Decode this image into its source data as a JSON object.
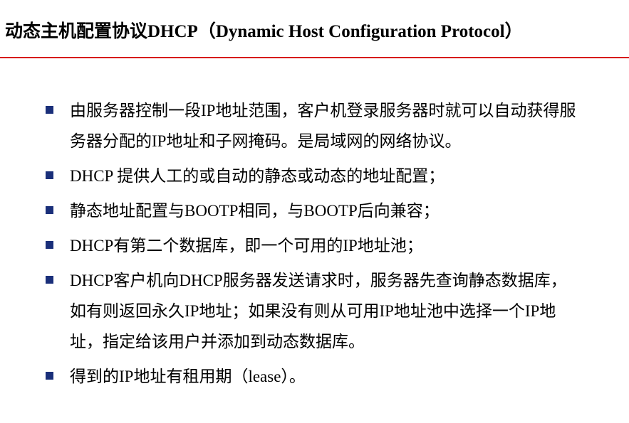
{
  "slide": {
    "title": "动态主机配置协议DHCP（Dynamic Host Configuration Protocol）",
    "accent_color": "#d7141a",
    "bullet_color": "#1a2f7a",
    "bullets": [
      {
        "text": "由服务器控制一段IP地址范围，客户机登录服务器时就可以自动获得服务器分配的IP地址和子网掩码。是局域网的网络协议。"
      },
      {
        "text": "DHCP 提供人工的或自动的静态或动态的地址配置；"
      },
      {
        "text": "静态地址配置与BOOTP相同，与BOOTP后向兼容；"
      },
      {
        "text": "DHCP有第二个数据库，即一个可用的IP地址池；"
      },
      {
        "text": "DHCP客户机向DHCP服务器发送请求时，服务器先查询静态数据库，如有则返回永久IP地址；如果没有则从可用IP地址池中选择一个IP地址，指定给该用户并添加到动态数据库。"
      },
      {
        "text": "得到的IP地址有租用期（lease）。"
      }
    ]
  }
}
